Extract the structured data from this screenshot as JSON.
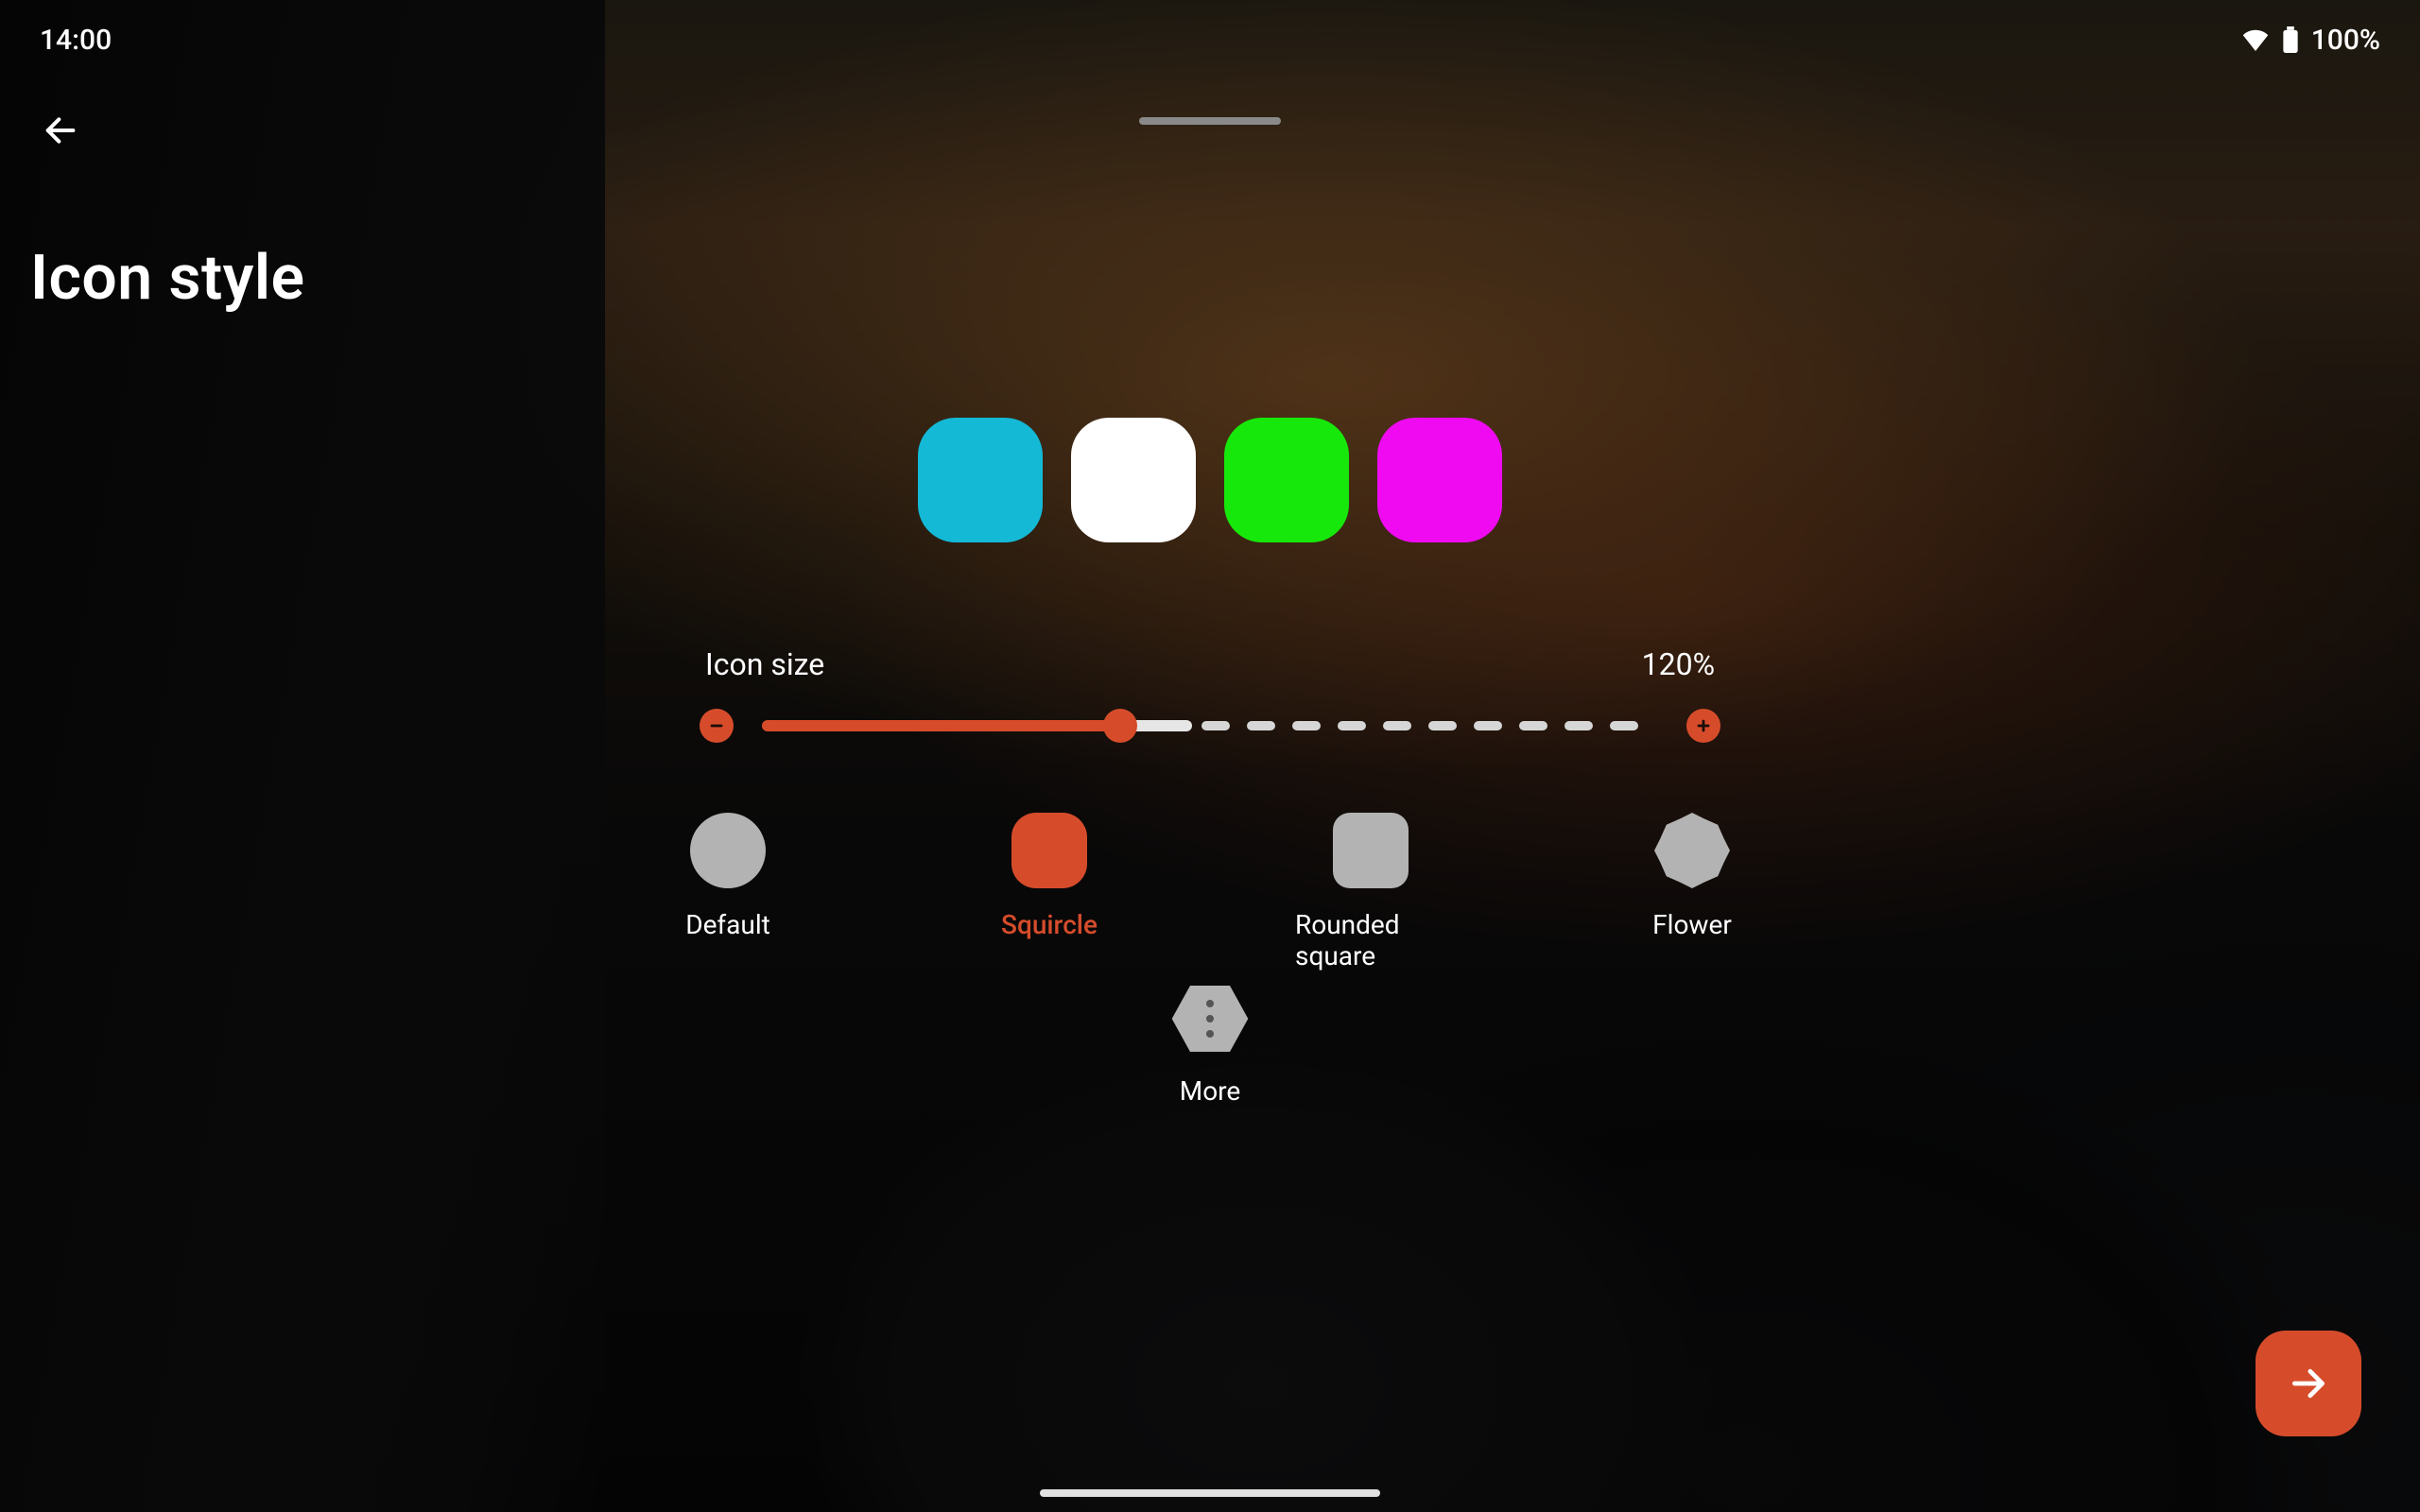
{
  "status": {
    "time": "14:00",
    "battery": "100%"
  },
  "header": {
    "title": "Icon style"
  },
  "preview": {
    "icons": [
      {
        "color": "#14b9d6"
      },
      {
        "color": "#ffffff"
      },
      {
        "color": "#17e80b"
      },
      {
        "color": "#ef0af2"
      }
    ]
  },
  "icon_size": {
    "label": "Icon size",
    "value_text": "120%",
    "value_percent": 40,
    "accent": "#d64c2b"
  },
  "shapes": {
    "options": [
      {
        "id": "default",
        "label": "Default",
        "kind": "circle",
        "selected": false
      },
      {
        "id": "squircle",
        "label": "Squircle",
        "kind": "squircle",
        "selected": true
      },
      {
        "id": "rounded-square",
        "label": "Rounded square",
        "kind": "rsquare",
        "selected": false
      },
      {
        "id": "flower",
        "label": "Flower",
        "kind": "flower",
        "selected": false
      }
    ],
    "more_label": "More"
  }
}
